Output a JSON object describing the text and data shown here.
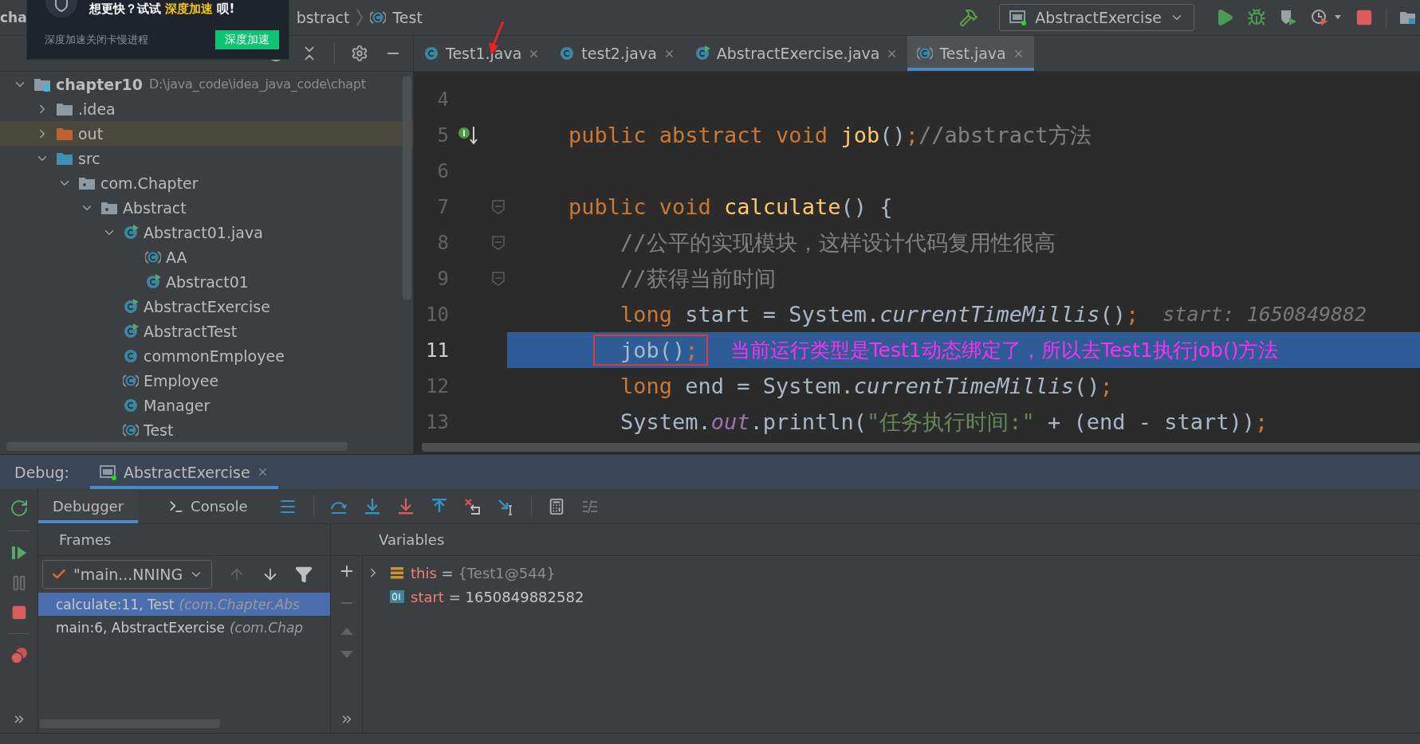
{
  "popup": {
    "headline": "想更快？试试",
    "highlight": "深度加速",
    "headline_end": "呗!",
    "message": "深度加速关闭卡慢进程",
    "button": "深度加速"
  },
  "breadcrumbs": [
    {
      "label": "cha",
      "kind": "module"
    },
    {
      "label": "bstract",
      "kind": "package"
    },
    {
      "label": "Test",
      "kind": "abstract"
    }
  ],
  "run_config": {
    "label": "AbstractExercise"
  },
  "editor_tabs": [
    {
      "label": "Test1.java",
      "kind": "class",
      "selected": false
    },
    {
      "label": "test2.java",
      "kind": "class",
      "selected": false
    },
    {
      "label": "AbstractExercise.java",
      "kind": "runnable",
      "selected": false
    },
    {
      "label": "Test.java",
      "kind": "abstract",
      "selected": true
    }
  ],
  "project_tree": [
    {
      "label": "chapter10",
      "path": "D:\\java_code\\idea_java_code\\chapt",
      "kind": "module",
      "expanded": true,
      "children": [
        {
          "label": ".idea",
          "kind": "folder",
          "expanded": false
        },
        {
          "label": "out",
          "kind": "excluded",
          "expanded": false
        },
        {
          "label": "src",
          "kind": "source",
          "expanded": true,
          "children": [
            {
              "label": "com.Chapter",
              "kind": "package",
              "expanded": true,
              "children": [
                {
                  "label": "Abstract",
                  "kind": "package",
                  "expanded": true,
                  "children": [
                    {
                      "label": "Abstract01.java",
                      "kind": "runnable",
                      "expanded": true,
                      "children": [
                        {
                          "label": "AA",
                          "kind": "abstract"
                        },
                        {
                          "label": "Abstract01",
                          "kind": "runnable"
                        }
                      ]
                    },
                    {
                      "label": "AbstractExercise",
                      "kind": "runnable"
                    },
                    {
                      "label": "AbstractTest",
                      "kind": "runnable"
                    },
                    {
                      "label": "commonEmployee",
                      "kind": "class"
                    },
                    {
                      "label": "Employee",
                      "kind": "abstract"
                    },
                    {
                      "label": "Manager",
                      "kind": "class"
                    },
                    {
                      "label": "Test",
                      "kind": "abstract"
                    }
                  ]
                }
              ]
            }
          ]
        }
      ]
    }
  ],
  "code_lines": [
    {
      "number": "4",
      "kind": "plain",
      "current": false
    },
    {
      "number": "5",
      "current": false,
      "kind": "implemented",
      "tokens": [
        {
          "text": "public abstract void ",
          "kind": "keyword"
        },
        {
          "text": "job",
          "kind": "function"
        },
        {
          "text": "()",
          "kind": "plain"
        },
        {
          "text": ";",
          "kind": "keyword"
        },
        {
          "text": "//abstract方法",
          "kind": "comment"
        }
      ]
    },
    {
      "number": "6",
      "kind": "plain",
      "current": false
    },
    {
      "number": "7",
      "current": false,
      "kind": "fold",
      "tokens": [
        {
          "text": "public void ",
          "kind": "keyword"
        },
        {
          "text": "calculate",
          "kind": "function"
        },
        {
          "text": "() {",
          "kind": "plain"
        }
      ],
      "children": [
        {
          "number": "8",
          "current": false,
          "kind": "fold",
          "tokens": [
            {
              "text": "//公平的实现模块，这样设计代码复用性很高",
              "kind": "comment"
            }
          ]
        },
        {
          "number": "9",
          "current": false,
          "kind": "fold",
          "tokens": [
            {
              "text": "//获得当前时间",
              "kind": "comment"
            }
          ]
        },
        {
          "number": "10",
          "kind": "plain",
          "current": false,
          "tokens": [
            {
              "text": "long ",
              "kind": "keyword"
            },
            {
              "text": "start = System.",
              "kind": "plain"
            },
            {
              "text": "currentTimeMillis",
              "kind": "static"
            },
            {
              "text": "()",
              "kind": "plain"
            },
            {
              "text": ";",
              "kind": "keyword"
            }
          ],
          "hint": "start: 1650849882"
        },
        {
          "number": "11",
          "kind": "plain",
          "current": true,
          "boxed": true,
          "tokens": [
            {
              "text": "job()",
              "kind": "plain"
            },
            {
              "text": ";",
              "kind": "keyword"
            }
          ],
          "note": "当前运行类型是Test1动态绑定了，所以去Test1执行job()方法"
        },
        {
          "number": "12",
          "kind": "plain",
          "current": false,
          "tokens": [
            {
              "text": "long ",
              "kind": "keyword"
            },
            {
              "text": "end = System.",
              "kind": "plain"
            },
            {
              "text": "currentTimeMillis",
              "kind": "static"
            },
            {
              "text": "()",
              "kind": "plain"
            },
            {
              "text": ";",
              "kind": "keyword"
            }
          ]
        },
        {
          "number": "13",
          "kind": "plain",
          "current": false,
          "tokens": [
            {
              "text": "System.",
              "kind": "plain"
            },
            {
              "text": "out",
              "kind": "field"
            },
            {
              "text": ".println(",
              "kind": "plain"
            },
            {
              "text": "\"任务执行时间:\"",
              "kind": "string"
            },
            {
              "text": " + (end - start))",
              "kind": "plain"
            },
            {
              "text": ";",
              "kind": "keyword"
            }
          ]
        }
      ]
    }
  ],
  "debug": {
    "title": "Debug:",
    "session_tab": {
      "label": "AbstractExercise",
      "selected": true
    },
    "tabs": [
      {
        "label": "Debugger",
        "kind": "plain",
        "selected": true
      },
      {
        "label": "Console",
        "kind": "console",
        "selected": false
      }
    ],
    "frames_title": "Frames",
    "variables_title": "Variables",
    "thread": {
      "label": "\"main...NNING"
    },
    "frames": [
      {
        "location": "calculate:11, Test",
        "package": "(com.Chapter.Abs",
        "selected": true
      },
      {
        "location": "main:6, AbstractExercise",
        "package": "(com.Chap",
        "selected": false
      }
    ],
    "variables": [
      {
        "name": "this",
        "operator": "=",
        "value": "{Test1@544}",
        "kind": "object",
        "expanded": false
      },
      {
        "name": "start",
        "operator": "=",
        "value": "1650849882582",
        "kind": "primitive"
      }
    ]
  }
}
